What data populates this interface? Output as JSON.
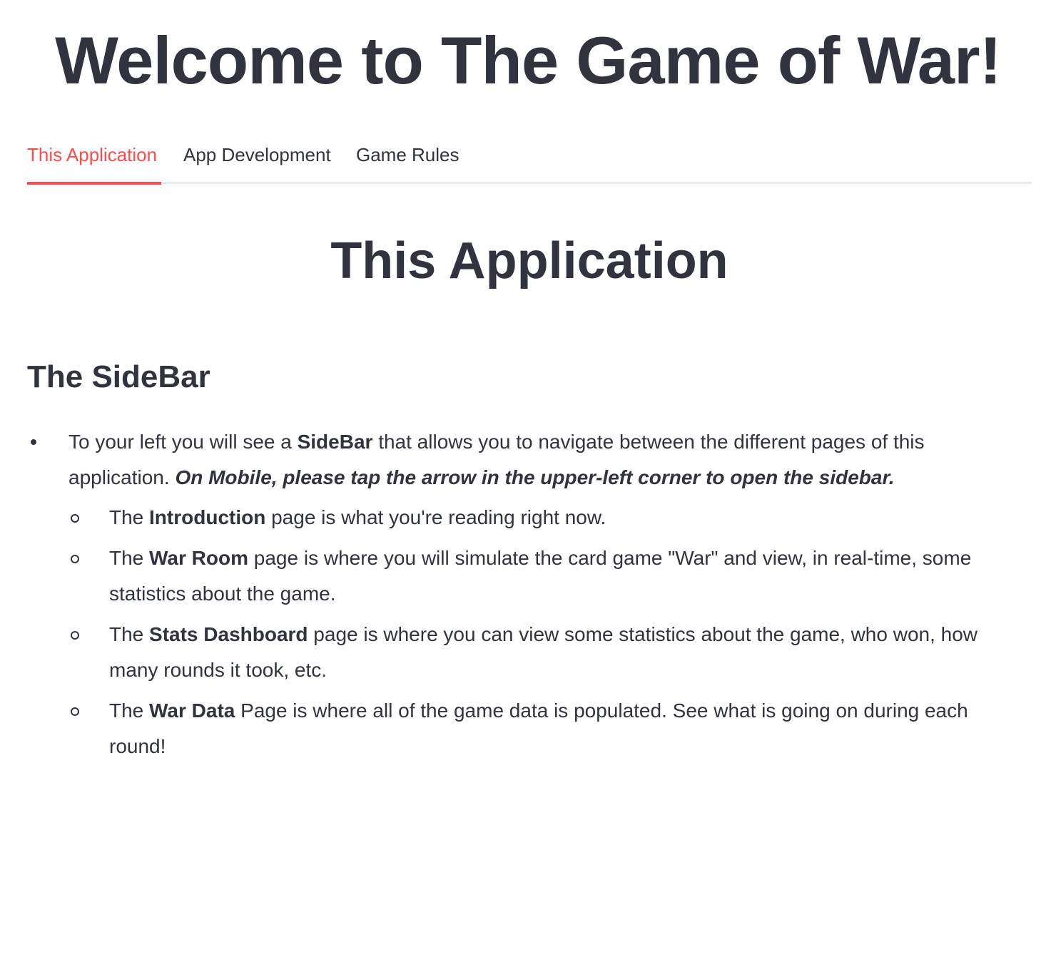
{
  "header": {
    "title": "Welcome to The Game of War!"
  },
  "tabs": [
    {
      "label": "This Application",
      "active": true
    },
    {
      "label": "App Development",
      "active": false
    },
    {
      "label": "Game Rules",
      "active": false
    }
  ],
  "colors": {
    "accent": "#ff4b4b",
    "text": "#31333f",
    "divider": "#ebebef"
  },
  "main": {
    "section_title": "This Application",
    "subheading": "The SideBar",
    "bullet": {
      "text_1": "To your left you will see a ",
      "bold_1": "SideBar",
      "text_2": " that allows you to navigate between the different pages of this application. ",
      "emphasis": "On Mobile, please tap the arrow in the upper-left corner to open the sidebar."
    },
    "sub_bullets": [
      {
        "prefix": "The ",
        "bold": "Introduction",
        "text": " page is what you're reading right now."
      },
      {
        "prefix": "The ",
        "bold": "War Room",
        "text": " page is where you will simulate the card game \"War\" and view, in real-time, some statistics about the game."
      },
      {
        "prefix": "The ",
        "bold": "Stats Dashboard",
        "text": " page is where you can view some statistics about the game, who won, how many rounds it took, etc."
      },
      {
        "prefix": "The ",
        "bold": "War Data",
        "text": " Page is where all of the game data is populated. See what is going on during each round!"
      }
    ]
  }
}
